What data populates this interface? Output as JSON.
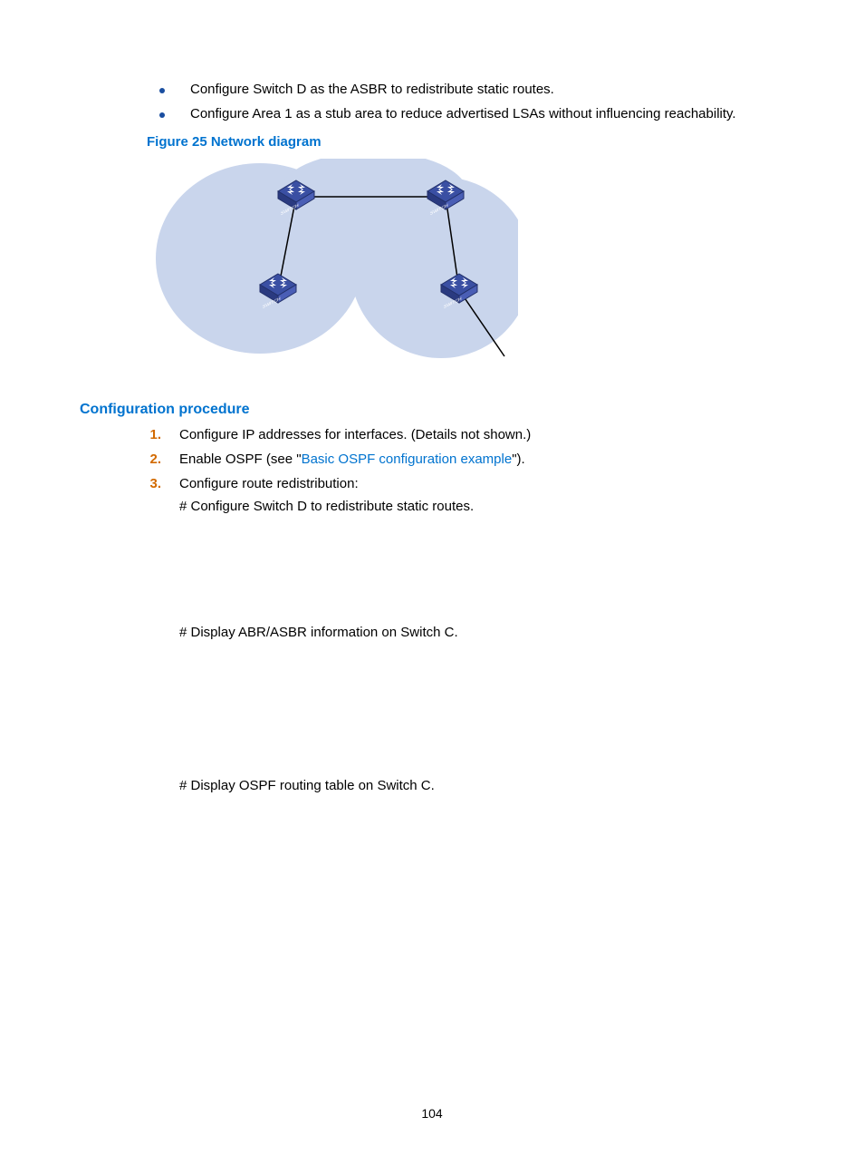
{
  "bullets": [
    "Configure Switch D as the ASBR to redistribute static routes.",
    "Configure Area 1 as a stub area to reduce advertised LSAs without influencing reachability."
  ],
  "figureCaption": "Figure 25 Network diagram",
  "sectionHeading": "Configuration procedure",
  "steps": [
    {
      "num": "1.",
      "text": "Configure IP addresses for interfaces. (Details not shown.)"
    },
    {
      "num": "2.",
      "prefix": "Enable OSPF (see \"",
      "link": "Basic OSPF configuration example",
      "suffix": "\")."
    },
    {
      "num": "3.",
      "text": "Configure route redistribution:",
      "sub": "# Configure Switch D to redistribute static routes."
    }
  ],
  "hash1": "# Display ABR/ASBR information on Switch C.",
  "hash2": "# Display OSPF routing table on Switch C.",
  "switchLabel": "SWITCH",
  "pageNumber": "104"
}
